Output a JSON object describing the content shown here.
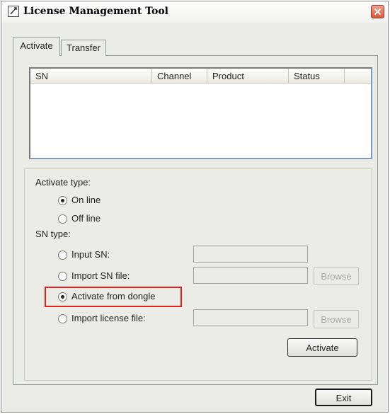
{
  "window": {
    "title": "License Management Tool"
  },
  "tabs": [
    {
      "label": "Activate",
      "active": true
    },
    {
      "label": "Transfer",
      "active": false
    }
  ],
  "list": {
    "columns": [
      "SN",
      "Channel",
      "Product",
      "Status"
    ],
    "rows": []
  },
  "activate_type": {
    "label": "Activate type:",
    "options": [
      {
        "label": "On line",
        "selected": true
      },
      {
        "label": "Off line",
        "selected": false
      }
    ]
  },
  "sn_type": {
    "label": "SN type:",
    "options": [
      {
        "label": "Input SN:",
        "selected": false
      },
      {
        "label": "Import SN file:",
        "selected": false
      },
      {
        "label": "Activate from dongle",
        "selected": true
      },
      {
        "label": "Import license file:",
        "selected": false
      }
    ],
    "input_sn_value": "",
    "sn_file_value": "",
    "license_file_value": "",
    "browse_label": "Browse"
  },
  "buttons": {
    "activate": "Activate",
    "exit": "Exit"
  },
  "colors": {
    "highlight": "#e0201f",
    "close_button": "#d9573c"
  }
}
